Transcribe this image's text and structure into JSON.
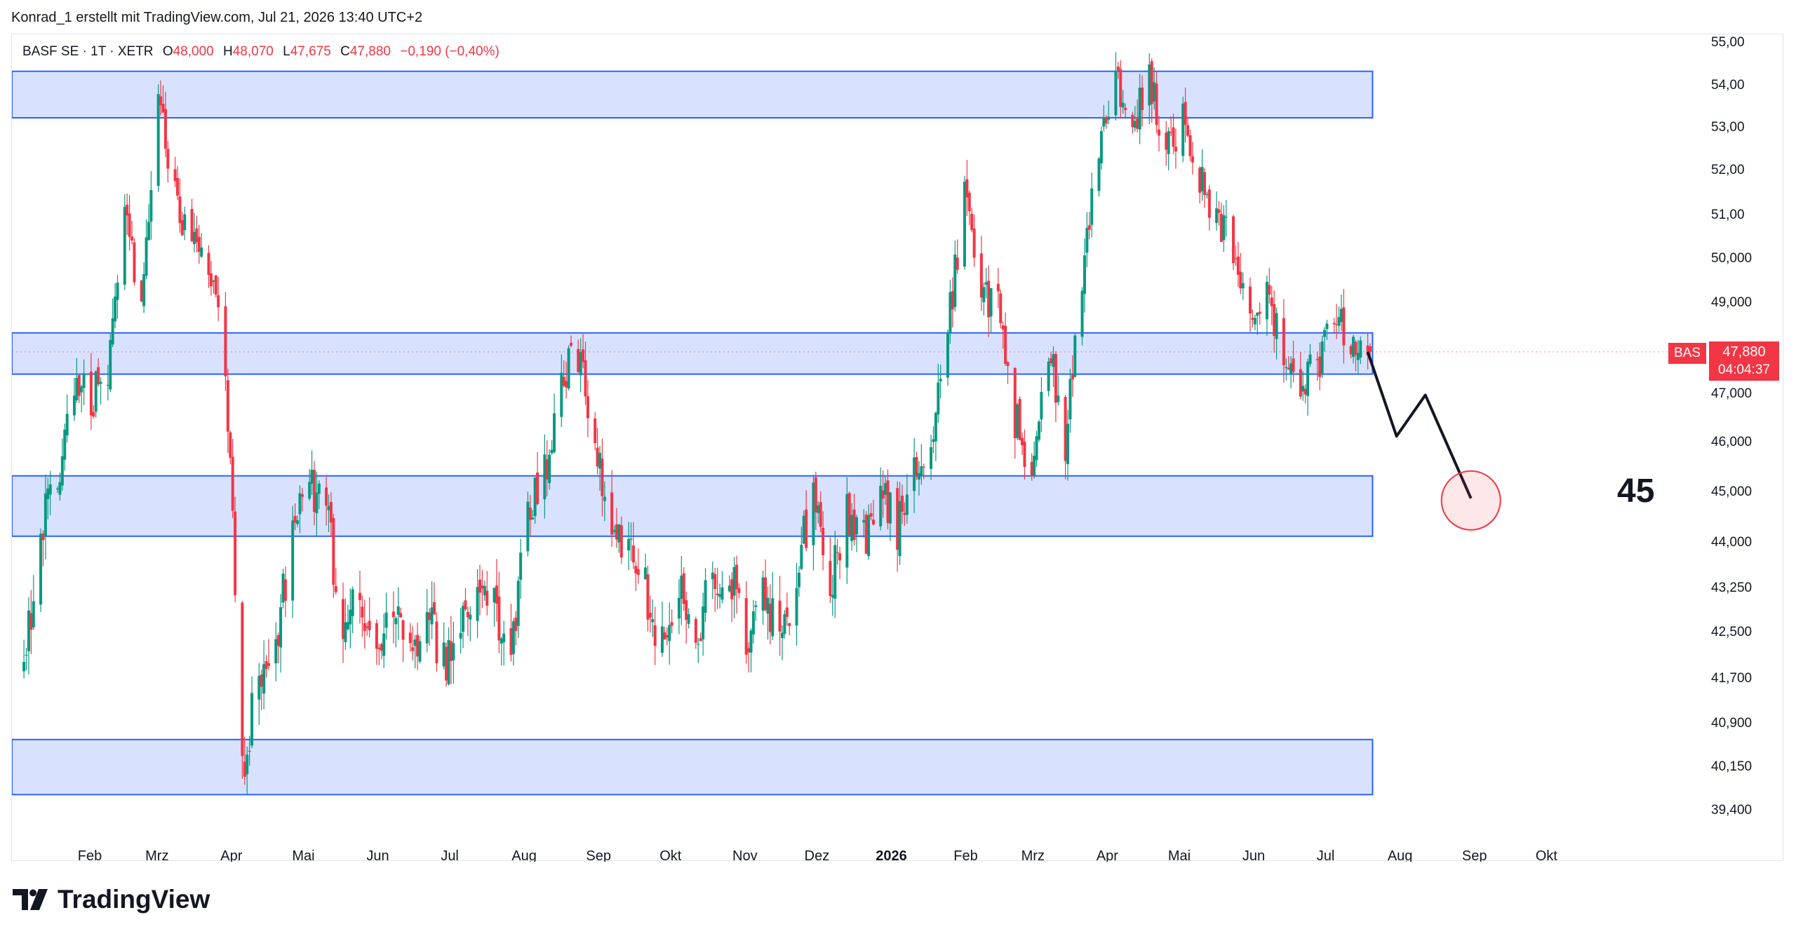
{
  "attribution": "Konrad_1 erstellt mit TradingView.com, Jul 21, 2026 13:40 UTC+2",
  "legend": {
    "symbol": "BASF SE · 1T · XETR",
    "open_label": "O",
    "open": "48,000",
    "high_label": "H",
    "high": "48,070",
    "low_label": "L",
    "low": "47,675",
    "close_label": "C",
    "close": "47,880",
    "change": "−0,190 (−0,40%)"
  },
  "price_label": {
    "symbol": "BAS",
    "price": "47,880",
    "countdown": "04:04:37"
  },
  "brand": "TradingView",
  "colors": {
    "up": "#089981",
    "down": "#f23645",
    "zone_fill": "#d6e0ff",
    "zone_border": "#2962ff",
    "target_circle": "#f23645"
  },
  "chart_data": {
    "type": "candlestick",
    "symbol": "BASF SE",
    "timeframe": "1T",
    "exchange": "XETR",
    "y_axis": {
      "position": "right",
      "tick_labels": [
        "55,00",
        "54,00",
        "53,00",
        "52,00",
        "51,00",
        "50,000",
        "49,000",
        "48,000",
        "47,000",
        "46,000",
        "45,000",
        "44,000",
        "43,250",
        "42,500",
        "41,700",
        "40,900",
        "40,150",
        "39,400"
      ],
      "tick_values": [
        55.0,
        54.0,
        53.0,
        52.0,
        51.0,
        50.0,
        49.0,
        48.0,
        47.0,
        46.0,
        45.0,
        44.0,
        43.25,
        42.5,
        41.7,
        40.9,
        40.15,
        39.4
      ]
    },
    "x_axis": {
      "tick_labels": [
        "Feb",
        "Mrz",
        "Apr",
        "Mai",
        "Jun",
        "Jul",
        "Aug",
        "Sep",
        "Okt",
        "Nov",
        "Dez",
        "2026",
        "Feb",
        "Mrz",
        "Apr",
        "Mai",
        "Jun",
        "Jul",
        "Aug",
        "Sep",
        "Okt"
      ],
      "tick_dates": [
        "2025-02-01",
        "2025-03-01",
        "2025-04-01",
        "2025-05-01",
        "2025-06-01",
        "2025-07-01",
        "2025-08-01",
        "2025-09-01",
        "2025-10-01",
        "2025-11-01",
        "2025-12-01",
        "2026-01-01",
        "2026-02-01",
        "2026-03-01",
        "2026-04-01",
        "2026-05-01",
        "2026-06-01",
        "2026-07-01",
        "2026-08-01",
        "2026-09-01",
        "2026-10-01"
      ]
    },
    "series_anchors": [
      [
        "2025-01-06",
        41.9
      ],
      [
        "2025-01-13",
        44.2
      ],
      [
        "2025-01-20",
        45.3
      ],
      [
        "2025-01-27",
        47.3
      ],
      [
        "2025-02-03",
        46.8
      ],
      [
        "2025-02-10",
        47.6
      ],
      [
        "2025-02-17",
        50.9
      ],
      [
        "2025-02-24",
        49.0
      ],
      [
        "2025-03-03",
        53.6
      ],
      [
        "2025-03-10",
        51.5
      ],
      [
        "2025-03-17",
        50.2
      ],
      [
        "2025-03-24",
        49.9
      ],
      [
        "2025-03-31",
        47.6
      ],
      [
        "2025-04-07",
        40.0
      ],
      [
        "2025-04-14",
        41.8
      ],
      [
        "2025-04-21",
        42.1
      ],
      [
        "2025-04-28",
        44.3
      ],
      [
        "2025-05-05",
        45.2
      ],
      [
        "2025-05-12",
        44.6
      ],
      [
        "2025-05-19",
        42.5
      ],
      [
        "2025-05-26",
        43.1
      ],
      [
        "2025-06-02",
        42.3
      ],
      [
        "2025-06-09",
        43.0
      ],
      [
        "2025-06-16",
        42.0
      ],
      [
        "2025-06-23",
        42.8
      ],
      [
        "2025-06-30",
        41.9
      ],
      [
        "2025-07-07",
        42.6
      ],
      [
        "2025-07-14",
        43.3
      ],
      [
        "2025-07-21",
        42.8
      ],
      [
        "2025-07-28",
        42.0
      ],
      [
        "2025-08-04",
        44.6
      ],
      [
        "2025-08-11",
        45.3
      ],
      [
        "2025-08-18",
        47.3
      ],
      [
        "2025-08-25",
        47.8
      ],
      [
        "2025-09-01",
        45.9
      ],
      [
        "2025-09-08",
        44.2
      ],
      [
        "2025-09-15",
        43.9
      ],
      [
        "2025-09-22",
        43.2
      ],
      [
        "2025-09-29",
        42.3
      ],
      [
        "2025-10-06",
        43.5
      ],
      [
        "2025-10-13",
        42.6
      ],
      [
        "2025-10-20",
        43.2
      ],
      [
        "2025-10-27",
        43.5
      ],
      [
        "2025-11-03",
        42.3
      ],
      [
        "2025-11-10",
        43.3
      ],
      [
        "2025-11-17",
        42.2
      ],
      [
        "2025-11-24",
        43.6
      ],
      [
        "2025-12-01",
        44.8
      ],
      [
        "2025-12-08",
        43.3
      ],
      [
        "2025-12-15",
        44.6
      ],
      [
        "2025-12-22",
        44.1
      ],
      [
        "2025-12-29",
        44.9
      ],
      [
        "2026-01-05",
        44.3
      ],
      [
        "2026-01-12",
        45.6
      ],
      [
        "2026-01-19",
        46.1
      ],
      [
        "2026-01-26",
        48.4
      ],
      [
        "2026-02-02",
        51.3
      ],
      [
        "2026-02-09",
        49.1
      ],
      [
        "2026-02-16",
        48.8
      ],
      [
        "2026-02-23",
        46.5
      ],
      [
        "2026-03-02",
        45.3
      ],
      [
        "2026-03-09",
        48.0
      ],
      [
        "2026-03-16",
        46.0
      ],
      [
        "2026-03-23",
        49.6
      ],
      [
        "2026-03-30",
        52.4
      ],
      [
        "2026-04-06",
        54.2
      ],
      [
        "2026-04-13",
        53.1
      ],
      [
        "2026-04-20",
        54.1
      ],
      [
        "2026-04-27",
        52.4
      ],
      [
        "2026-05-04",
        53.2
      ],
      [
        "2026-05-11",
        51.8
      ],
      [
        "2026-05-18",
        51.0
      ],
      [
        "2026-05-25",
        50.3
      ],
      [
        "2026-06-01",
        48.6
      ],
      [
        "2026-06-08",
        49.4
      ],
      [
        "2026-06-15",
        47.6
      ],
      [
        "2026-06-22",
        47.3
      ],
      [
        "2026-06-29",
        47.5
      ],
      [
        "2026-07-06",
        48.6
      ],
      [
        "2026-07-13",
        48.1
      ],
      [
        "2026-07-20",
        47.88
      ]
    ],
    "last_candle": {
      "date": "2026-07-21",
      "open": 48.0,
      "high": 48.07,
      "low": 47.675,
      "close": 47.88
    },
    "zones": [
      {
        "top": 54.3,
        "bottom": 53.2
      },
      {
        "top": 48.3,
        "bottom": 47.4
      },
      {
        "top": 45.3,
        "bottom": 44.1
      },
      {
        "top": 40.6,
        "bottom": 39.65
      }
    ],
    "zones_start_date": "2025-01-01",
    "zones_end_date": "2026-07-22",
    "projection_path": [
      [
        "2026-07-20",
        47.88
      ],
      [
        "2026-08-01",
        46.1
      ],
      [
        "2026-08-13",
        46.95
      ],
      [
        "2026-09-01",
        44.85
      ]
    ],
    "target": {
      "date": "2026-09-01",
      "value": 44.85,
      "label": "45"
    },
    "current_price": 47.88
  }
}
